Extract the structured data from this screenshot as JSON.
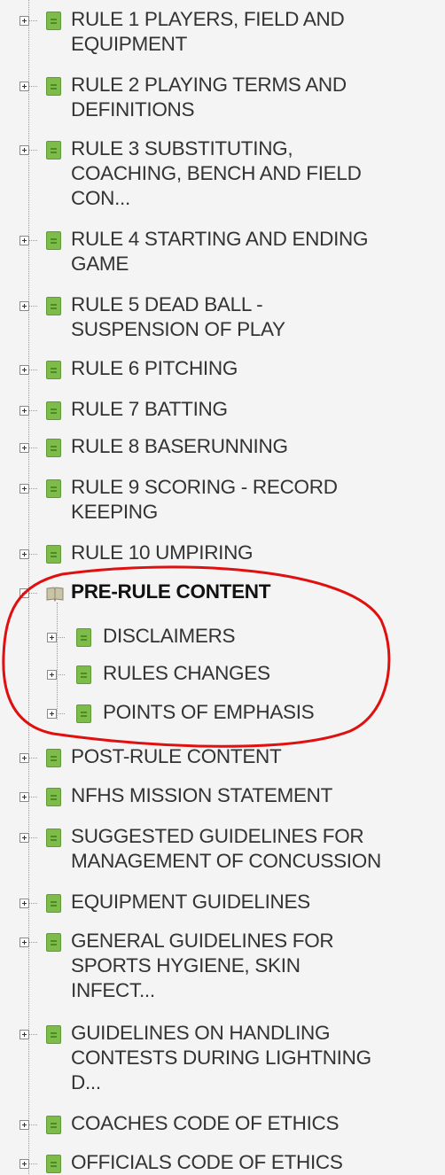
{
  "tree": {
    "items": [
      {
        "lines": [
          "RULE 1 PLAYERS, FIELD AND",
          "EQUIPMENT"
        ]
      },
      {
        "lines": [
          "RULE 2 PLAYING TERMS AND",
          "DEFINITIONS"
        ]
      },
      {
        "lines": [
          "RULE 3 SUBSTITUTING,",
          "COACHING, BENCH AND FIELD",
          "CON..."
        ]
      },
      {
        "lines": [
          "RULE 4 STARTING AND ENDING",
          "GAME"
        ]
      },
      {
        "lines": [
          "RULE 5 DEAD BALL -",
          "SUSPENSION OF PLAY"
        ]
      },
      {
        "lines": [
          "RULE 6 PITCHING"
        ]
      },
      {
        "lines": [
          "RULE 7 BATTING"
        ]
      },
      {
        "lines": [
          "RULE 8 BASERUNNING"
        ]
      },
      {
        "lines": [
          "RULE 9 SCORING - RECORD",
          "KEEPING"
        ]
      },
      {
        "lines": [
          "RULE 10 UMPIRING"
        ]
      },
      {
        "lines": [
          "PRE-RULE CONTENT"
        ],
        "expanded": true,
        "bold": true,
        "icon": "open-book-icon"
      },
      {
        "lines": [
          "DISCLAIMERS"
        ],
        "child": true
      },
      {
        "lines": [
          "RULES CHANGES"
        ],
        "child": true
      },
      {
        "lines": [
          "POINTS OF EMPHASIS"
        ],
        "child": true
      },
      {
        "lines": [
          "POST-RULE CONTENT"
        ]
      },
      {
        "lines": [
          "NFHS MISSION STATEMENT"
        ]
      },
      {
        "lines": [
          "SUGGESTED GUIDELINES FOR",
          "MANAGEMENT OF CONCUSSION"
        ]
      },
      {
        "lines": [
          "EQUIPMENT GUIDELINES"
        ]
      },
      {
        "lines": [
          "GENERAL GUIDELINES FOR",
          "SPORTS HYGIENE, SKIN",
          "INFECT..."
        ]
      },
      {
        "lines": [
          "GUIDELINES ON HANDLING",
          "CONTESTS DURING LIGHTNING",
          "D..."
        ]
      },
      {
        "lines": [
          "COACHES CODE OF ETHICS"
        ]
      },
      {
        "lines": [
          "OFFICIALS CODE OF ETHICS"
        ]
      }
    ]
  },
  "colors": {
    "page_icon": "#7dbb4a",
    "highlight_circle": "#e01010",
    "background": "#f4f4f4"
  }
}
